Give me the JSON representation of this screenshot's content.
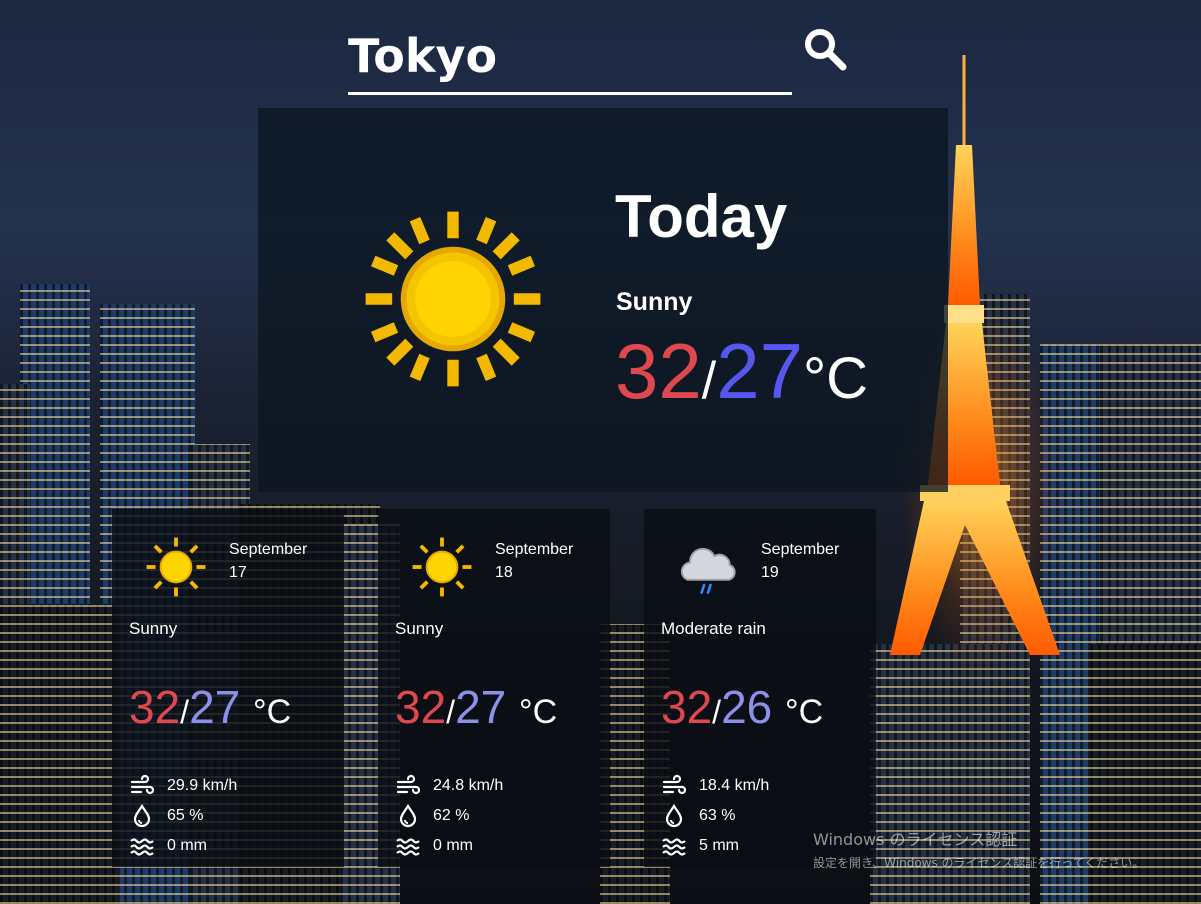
{
  "search": {
    "value": "Tokyo"
  },
  "today": {
    "title": "Today",
    "condition": "Sunny",
    "high": "32",
    "low": "27",
    "separator": "/",
    "unit": "°C",
    "icon": "sun-icon"
  },
  "days": [
    {
      "month": "September",
      "day": "17",
      "condition": "Sunny",
      "high": "32",
      "low": "27",
      "separator": "/",
      "unit": "°C",
      "wind": "29.9 km/h",
      "humidity": "65 %",
      "precip": "0 mm",
      "icon": "sun-icon"
    },
    {
      "month": "September",
      "day": "18",
      "condition": "Sunny",
      "high": "32",
      "low": "27",
      "separator": "/",
      "unit": "°C",
      "wind": "24.8 km/h",
      "humidity": "62 %",
      "precip": "0 mm",
      "icon": "sun-icon"
    },
    {
      "month": "September",
      "day": "19",
      "condition": "Moderate rain",
      "high": "32",
      "low": "26",
      "separator": "/",
      "unit": "°C",
      "wind": "18.4 km/h",
      "humidity": "63 %",
      "precip": "5 mm",
      "icon": "rain-cloud-icon"
    }
  ],
  "watermark": {
    "line1": "Windows のライセンス認証",
    "line2": "設定を開き、Windows のライセンス認証を行ってください。"
  },
  "colors": {
    "high": "#e0484f",
    "low_today": "#5757f0",
    "low_day": "#8c91e8"
  }
}
